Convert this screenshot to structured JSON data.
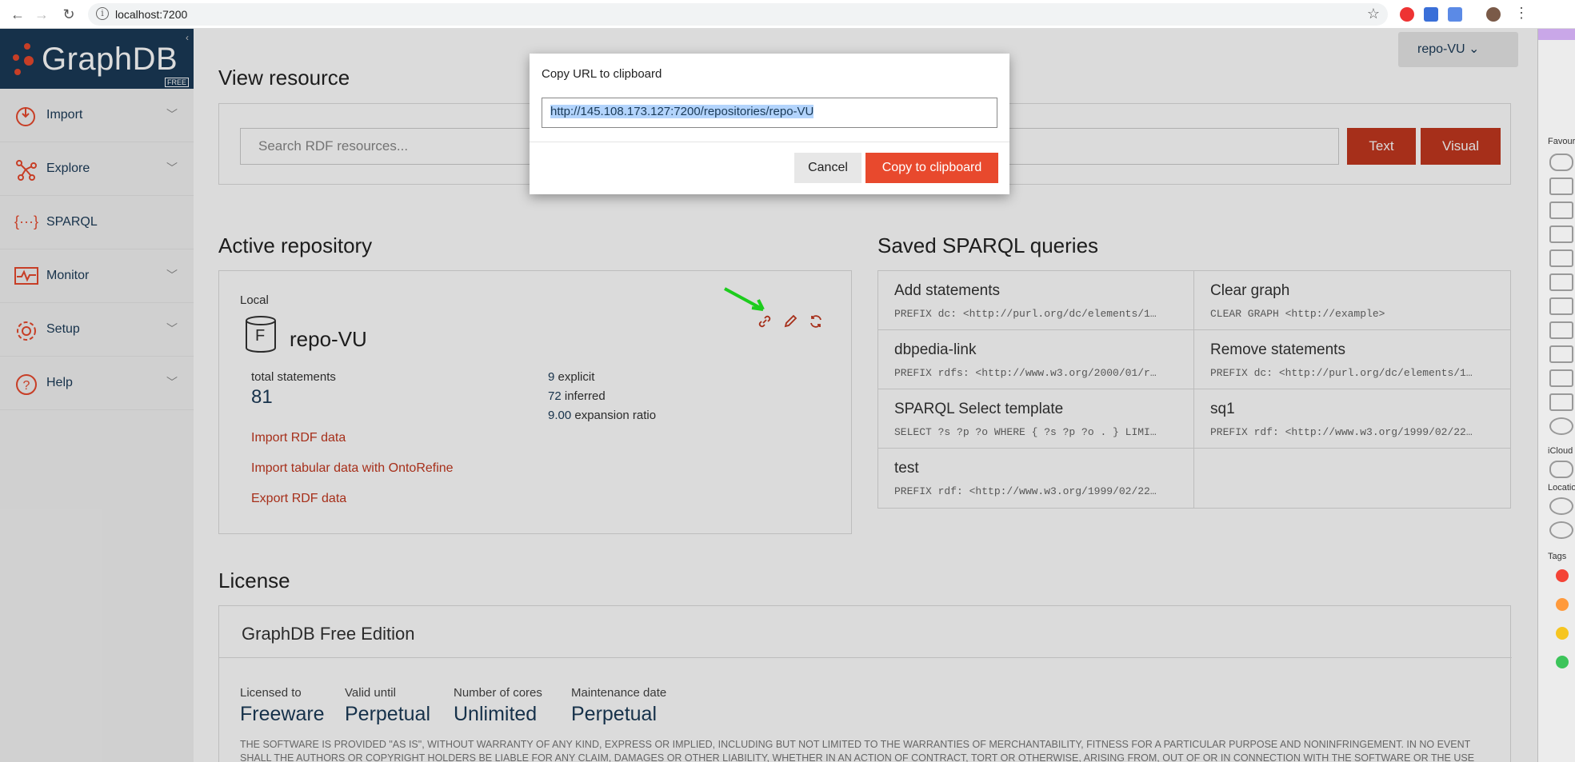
{
  "browser": {
    "url": "localhost:7200"
  },
  "sidebar": {
    "logo": "GraphDB",
    "edition_badge": "FREE",
    "items": [
      {
        "label": "Import"
      },
      {
        "label": "Explore"
      },
      {
        "label": "SPARQL"
      },
      {
        "label": "Monitor"
      },
      {
        "label": "Setup"
      },
      {
        "label": "Help"
      }
    ]
  },
  "header": {
    "repo_selector": "repo-VU"
  },
  "view_resource": {
    "title": "View resource",
    "search_placeholder": "Search RDF resources...",
    "text_button": "Text",
    "visual_button": "Visual"
  },
  "active_repo": {
    "title": "Active repository",
    "location": "Local",
    "repo_badge": "F",
    "repo_name": "repo-VU",
    "total_label": "total statements",
    "total_value": "81",
    "explicit_value": "9",
    "explicit_label": "explicit",
    "inferred_value": "72",
    "inferred_label": "inferred",
    "ratio_value": "9.00",
    "ratio_label": "expansion ratio",
    "links": [
      "Import RDF data",
      "Import tabular data with OntoRefine",
      "Export RDF data"
    ]
  },
  "saved_queries": {
    "title": "Saved SPARQL queries",
    "items": [
      {
        "name": "Add statements",
        "code": "PREFIX dc: <http://purl.org/dc/elements/1…"
      },
      {
        "name": "Clear graph",
        "code": "CLEAR GRAPH <http://example>"
      },
      {
        "name": "dbpedia-link",
        "code": "PREFIX rdfs: <http://www.w3.org/2000/01/r…"
      },
      {
        "name": "Remove statements",
        "code": "PREFIX dc: <http://purl.org/dc/elements/1…"
      },
      {
        "name": "SPARQL Select template",
        "code": "SELECT ?s ?p ?o WHERE { ?s ?p ?o . } LIMI…"
      },
      {
        "name": "sq1",
        "code": "PREFIX rdf: <http://www.w3.org/1999/02/22…"
      },
      {
        "name": "test",
        "code": "PREFIX rdf: <http://www.w3.org/1999/02/22…"
      }
    ]
  },
  "license": {
    "section_title": "License",
    "edition": "GraphDB Free Edition",
    "licensed_to_label": "Licensed to",
    "licensed_to": "Freeware",
    "valid_until_label": "Valid until",
    "valid_until": "Perpetual",
    "cores_label": "Number of cores",
    "cores": "Unlimited",
    "maintenance_label": "Maintenance date",
    "maintenance": "Perpetual",
    "disclaimer": "THE SOFTWARE IS PROVIDED \"AS IS\", WITHOUT WARRANTY OF ANY KIND, EXPRESS OR IMPLIED, INCLUDING BUT NOT LIMITED TO THE WARRANTIES OF MERCHANTABILITY, FITNESS FOR A PARTICULAR PURPOSE AND NONINFRINGEMENT. IN NO EVENT SHALL THE AUTHORS OR COPYRIGHT HOLDERS BE LIABLE FOR ANY CLAIM, DAMAGES OR OTHER LIABILITY, WHETHER IN AN ACTION OF CONTRACT, TORT OR OTHERWISE, ARISING FROM, OUT OF OR IN CONNECTION WITH THE SOFTWARE OR THE USE OR OTHER DEALINGS IN THE SOFTWARE."
  },
  "modal": {
    "title": "Copy URL to clipboard",
    "url_value": "http://145.108.173.127:7200/repositories/repo-VU",
    "cancel": "Cancel",
    "copy": "Copy to clipboard"
  },
  "finder": {
    "favourites": "Favouri",
    "icloud": "iCloud",
    "locations": "Locatio",
    "tags": "Tags",
    "tag_colors": [
      "#f44336",
      "#ff9a3c",
      "#f6c520",
      "#3cc45a"
    ]
  },
  "colors": {
    "accent": "#e8492d",
    "brand": "#1a3a57"
  }
}
